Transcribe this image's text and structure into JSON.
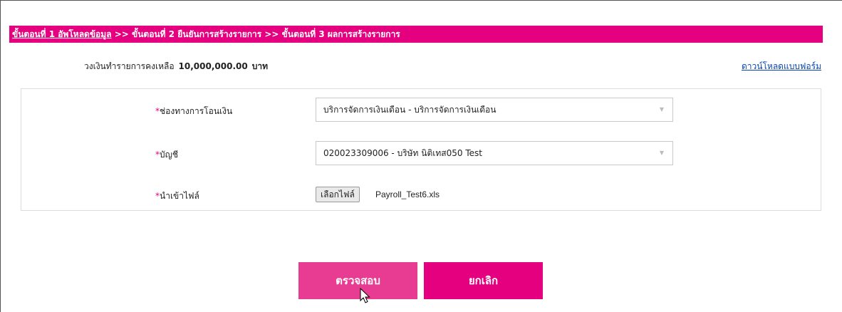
{
  "steps": {
    "step1": "ขั้นตอนที่ 1 อัพโหลดข้อมูล",
    "sep1": " >> ",
    "step2": "ขั้นตอนที่ 2 ยืนยันการสร้างรายการ",
    "sep2": "  >> ",
    "step3": "ขั้นตอนที่ 3 ผลการสร้างรายการ"
  },
  "balance": {
    "label": "วงเงินทำรายการคงเหลือ",
    "amount": "10,000,000.00",
    "unit": "บาท"
  },
  "download_form_link": "ดาวน์โหลดแบบฟอร์ม",
  "form": {
    "channel": {
      "required_mark": "*",
      "label": "ช่องทางการโอนเงิน",
      "selected": "บริการจัดการเงินเดือน - บริการจัดการเงินเดือน"
    },
    "account": {
      "required_mark": "*",
      "label": "บัญชี",
      "selected": "020023309006 - บริษัท นิติเทส050 Test"
    },
    "file": {
      "required_mark": "*",
      "label": "นำเข้าไฟล์",
      "button_label": "เลือกไฟล์",
      "file_name": "Payroll_Test6.xls"
    }
  },
  "buttons": {
    "check": "ตรวจสอบ",
    "cancel": "ยกเลิก"
  },
  "colors": {
    "brand_pink": "#e4007f",
    "button_hover_pink": "#e83c93"
  },
  "icons": {
    "dropdown": "triangle-down",
    "cursor": "mouse-pointer"
  }
}
